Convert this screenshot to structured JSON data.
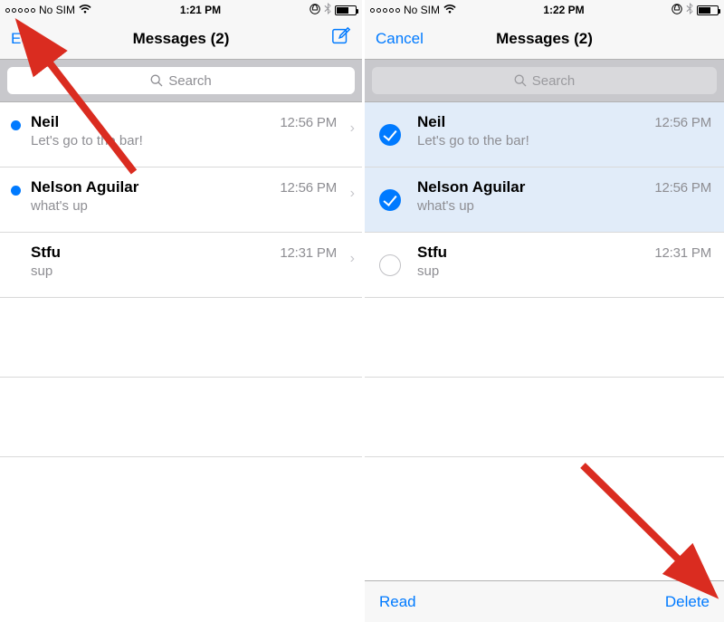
{
  "colors": {
    "accent": "#007aff",
    "arrow": "#da2c20"
  },
  "left": {
    "status": {
      "carrier": "No SIM",
      "time": "1:21 PM"
    },
    "nav": {
      "left_btn": "Edit",
      "title": "Messages (2)"
    },
    "search": {
      "placeholder": "Search"
    },
    "rows": [
      {
        "name": "Neil",
        "time": "12:56 PM",
        "preview": "Let's go to the bar!",
        "unread": true
      },
      {
        "name": "Nelson Aguilar",
        "time": "12:56 PM",
        "preview": "what's up",
        "unread": true
      },
      {
        "name": "Stfu",
        "time": "12:31 PM",
        "preview": "sup",
        "unread": false
      }
    ]
  },
  "right": {
    "status": {
      "carrier": "No SIM",
      "time": "1:22 PM"
    },
    "nav": {
      "left_btn": "Cancel",
      "title": "Messages (2)"
    },
    "search": {
      "placeholder": "Search"
    },
    "rows": [
      {
        "name": "Neil",
        "time": "12:56 PM",
        "preview": "Let's go to the bar!",
        "selected": true
      },
      {
        "name": "Nelson Aguilar",
        "time": "12:56 PM",
        "preview": "what's up",
        "selected": true
      },
      {
        "name": "Stfu",
        "time": "12:31 PM",
        "preview": "sup",
        "selected": false
      }
    ],
    "toolbar": {
      "read_label": "Read",
      "delete_label": "Delete"
    }
  }
}
